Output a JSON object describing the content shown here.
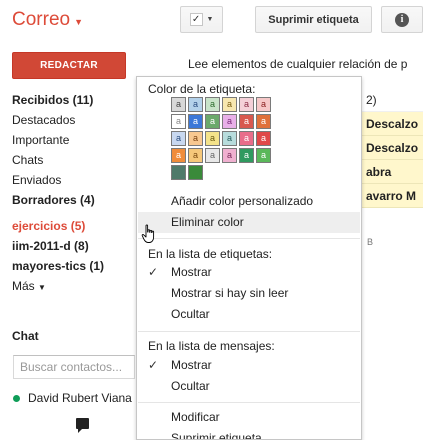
{
  "header": {
    "brand": "Correo",
    "remove_label": "Suprimir etiqueta",
    "check_glyph": "✓",
    "info_glyph": "i"
  },
  "compose": {
    "label": "REDACTAR"
  },
  "nav": {
    "items": [
      {
        "label": "Recibidos (11)",
        "bold": true
      },
      {
        "label": "Destacados"
      },
      {
        "label": "Importante"
      },
      {
        "label": "Chats"
      },
      {
        "label": "Enviados"
      },
      {
        "label": "Borradores (4)",
        "bold": true
      },
      {
        "label": "ejercicios (5)",
        "active": true
      },
      {
        "label": "iim-2011-d (8)",
        "bold": true
      },
      {
        "label": "mayores-tics (1)",
        "bold": true
      },
      {
        "label": "Más"
      }
    ]
  },
  "chat": {
    "title": "Chat",
    "search_placeholder": "Buscar contactos...",
    "contact": "David Rubert Viana",
    "status_color": "#0f9d58"
  },
  "main": {
    "intro": "Lee elementos de cualquier relación de p",
    "rows": [
      "2)",
      "Descalzo",
      "Descalzo",
      "abra",
      "avarro M",
      "B"
    ]
  },
  "menu": {
    "color_header": "Color de la etiqueta:",
    "add_custom": "Añadir color personalizado",
    "remove_color": "Eliminar color",
    "label_list_header": "En la lista de etiquetas:",
    "label_list_options": [
      "Mostrar",
      "Mostrar si hay sin leer",
      "Ocultar"
    ],
    "message_list_header": "En la lista de mensajes:",
    "message_list_options": [
      "Mostrar",
      "Ocultar"
    ],
    "edit": "Modificar",
    "delete": "Suprimir etiqueta",
    "swatch_letter": "a",
    "swatch_rows": [
      [
        {
          "bg": "#d8d8d8",
          "fg": "#444444"
        },
        {
          "bg": "#b3d1ea",
          "fg": "#2a4d80"
        },
        {
          "bg": "#c9e3c9",
          "fg": "#2b6b2b"
        },
        {
          "bg": "#f7e7b0",
          "fg": "#7a5c10"
        },
        {
          "bg": "#f4d0d8",
          "fg": "#8a2a44"
        },
        {
          "bg": "#f6c8c8",
          "fg": "#8a2020"
        }
      ],
      [
        {
          "bg": "#ffffff",
          "fg": "#888888"
        },
        {
          "bg": "#3c78d8",
          "fg": "#ffffff"
        },
        {
          "bg": "#6ba96b",
          "fg": "#ffffff"
        },
        {
          "bg": "#e8b0e8",
          "fg": "#7a2a7a"
        },
        {
          "bg": "#d8584f",
          "fg": "#ffffff"
        },
        {
          "bg": "#e0703a",
          "fg": "#ffffff"
        }
      ],
      [
        {
          "bg": "#c8d8f0",
          "fg": "#2a4d80"
        },
        {
          "bg": "#f8c890",
          "fg": "#7a4210"
        },
        {
          "bg": "#f4e38a",
          "fg": "#6a5a10"
        },
        {
          "bg": "#b8dcdc",
          "fg": "#2a6060"
        },
        {
          "bg": "#e86d8a",
          "fg": "#ffffff"
        },
        {
          "bg": "#e04848",
          "fg": "#ffffff"
        }
      ],
      [
        {
          "bg": "#f08c3a",
          "fg": "#ffffff"
        },
        {
          "bg": "#f6c87a",
          "fg": "#7a4a10"
        },
        {
          "bg": "#e8e8e8",
          "fg": "#666666"
        },
        {
          "bg": "#f0b0d0",
          "fg": "#7a2a5a"
        },
        {
          "bg": "#2f9a5f",
          "fg": "#ffffff"
        },
        {
          "bg": "#5ab85a",
          "fg": "#ffffff"
        }
      ],
      [
        {
          "bg": "#4f7a6a",
          "fg": "#ffffff"
        },
        {
          "bg": "#3a8a3a",
          "fg": "#ffffff"
        }
      ]
    ]
  }
}
